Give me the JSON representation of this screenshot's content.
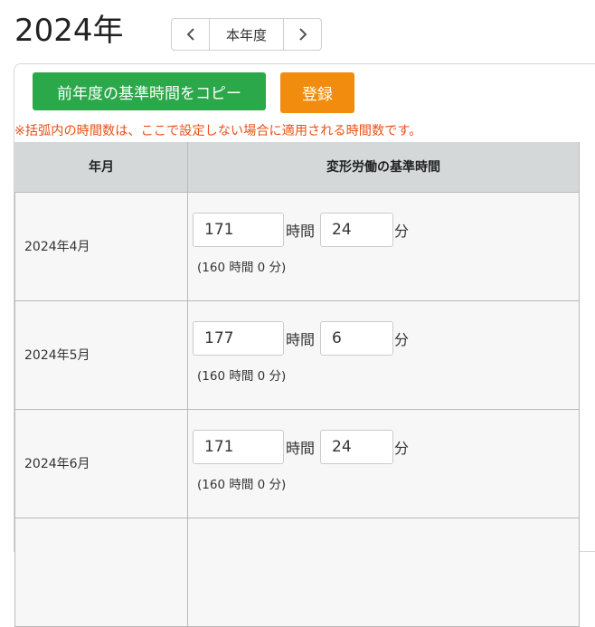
{
  "header": {
    "year_title": "2024年",
    "nav": {
      "prev_icon": "chevron-left-icon",
      "current_label": "本年度",
      "next_icon": "chevron-right-icon"
    }
  },
  "toolbar": {
    "copy_label": "前年度の基準時間をコピー",
    "register_label": "登録",
    "copy_color": "#2ba84a",
    "register_color": "#f28c0f"
  },
  "notice": "※括弧内の時間数は、ここで設定しない場合に適用される時間数です。",
  "table": {
    "columns": [
      "年月",
      "変形労働の基準時間"
    ],
    "hour_unit": "時間",
    "minute_unit": "分",
    "rows": [
      {
        "month": "2024年4月",
        "hours": "171",
        "minutes": "24",
        "default_text": "(160 時間 0 分)"
      },
      {
        "month": "2024年5月",
        "hours": "177",
        "minutes": "6",
        "default_text": "(160 時間 0 分)"
      },
      {
        "month": "2024年6月",
        "hours": "171",
        "minutes": "24",
        "default_text": "(160 時間 0 分)"
      }
    ]
  }
}
